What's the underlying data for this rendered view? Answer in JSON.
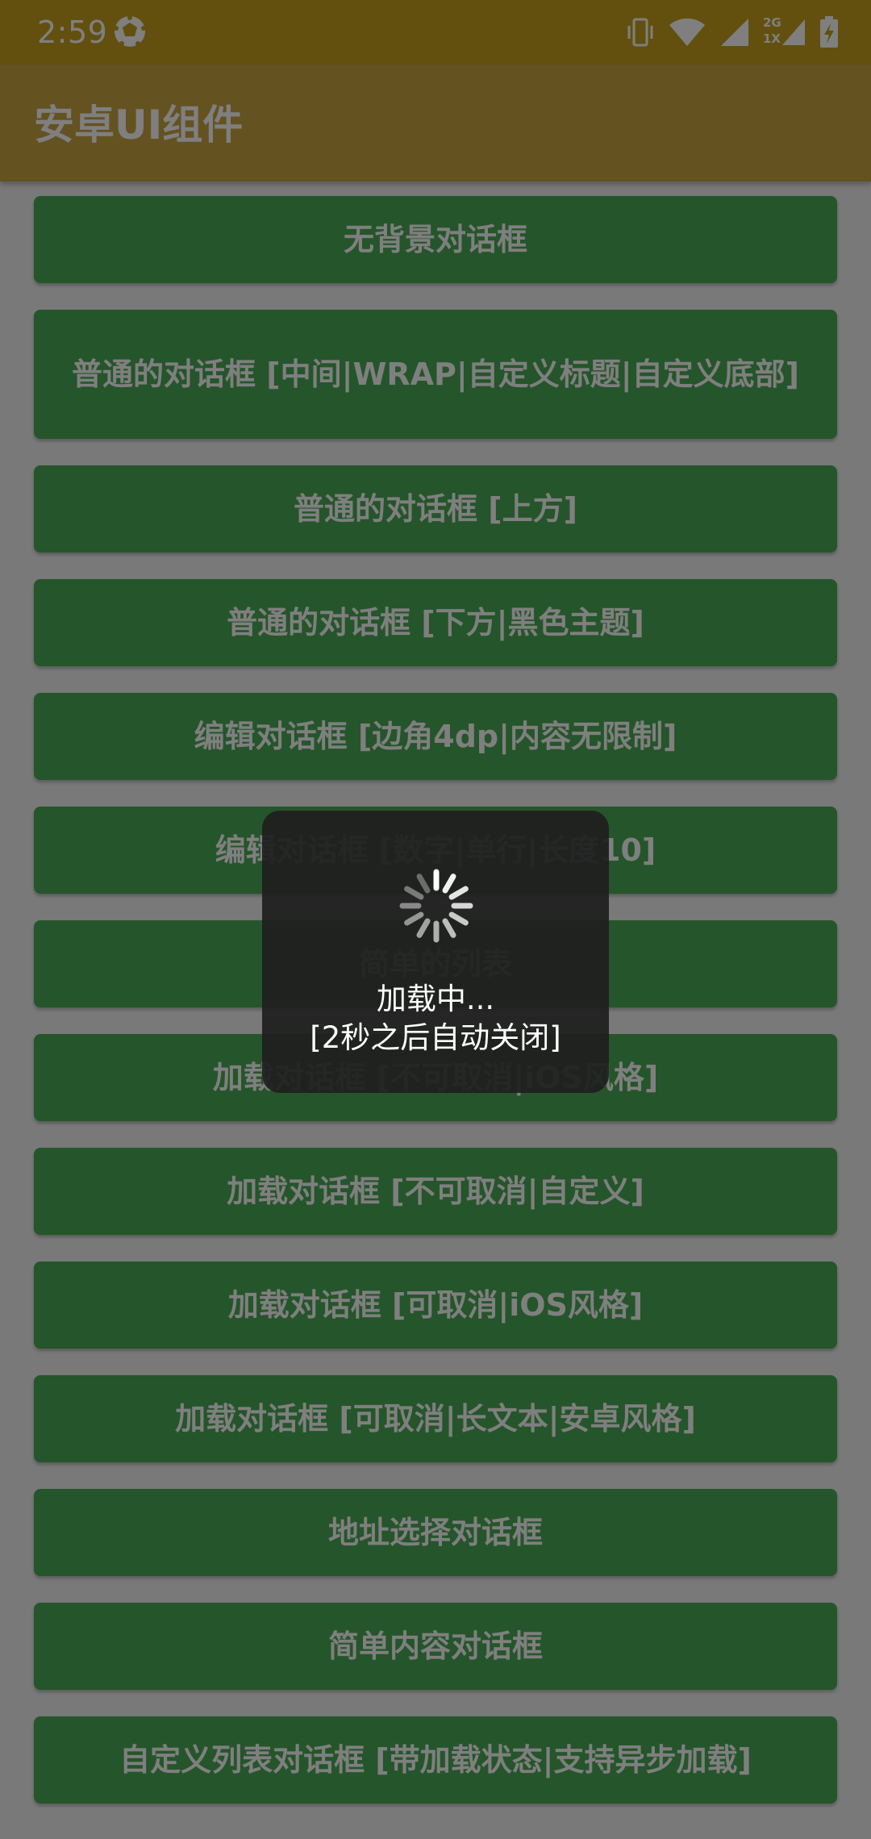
{
  "status_bar": {
    "time": "2:59",
    "network_type_top": "2G",
    "network_type_bottom": "1X",
    "icons": [
      "app-notification-icon",
      "vibrate-icon",
      "wifi-icon",
      "cell-signal-icon",
      "cell-signal-2g-icon",
      "battery-charging-icon"
    ]
  },
  "app_bar": {
    "title": "安卓UI组件"
  },
  "buttons": [
    "无背景对话框",
    "普通的对话框 [中间|WRAP|自定义标题|自定义底部]",
    "普通的对话框 [上方]",
    "普通的对话框 [下方|黑色主题]",
    "编辑对话框 [边角4dp|内容无限制]",
    "编辑对话框 [数字|单行|长度10]",
    "简单的列表",
    "加载对话框 [不可取消|iOS风格]",
    "加载对话框 [不可取消|自定义]",
    "加载对话框 [可取消|iOS风格]",
    "加载对话框 [可取消|长文本|安卓风格]",
    "地址选择对话框",
    "简单内容对话框",
    "自定义列表对话框 [带加载状态|支持异步加载]"
  ],
  "loading_dialog": {
    "line1": "加载中...",
    "line2": "[2秒之后自动关闭]"
  },
  "colors": {
    "status_bar": "#c6a11d",
    "app_bar": "#caa542",
    "button": "#4aaa55",
    "background": "#f3f3f3",
    "scrim": "rgba(0,0,0,0.5)"
  }
}
